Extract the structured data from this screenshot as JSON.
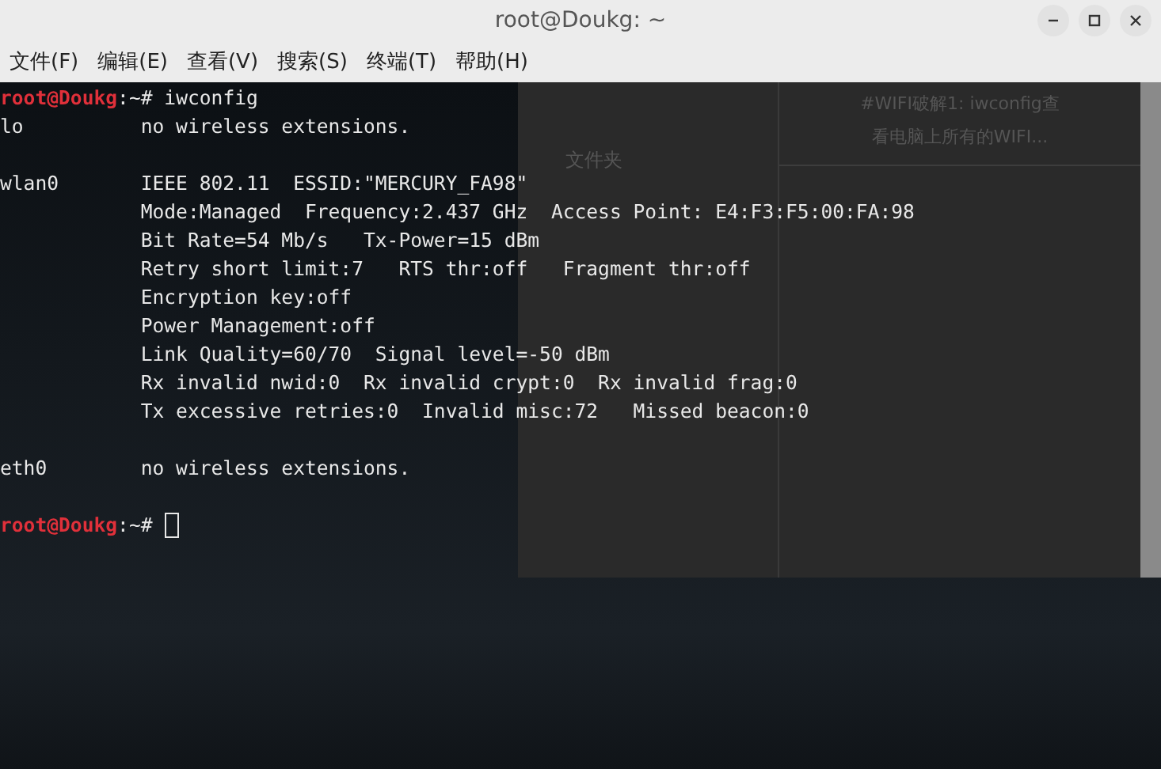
{
  "window": {
    "title": "root@Doukg: ~"
  },
  "menu": [
    "文件(F)",
    "编辑(E)",
    "查看(V)",
    "搜索(S)",
    "终端(T)",
    "帮助(H)"
  ],
  "background_window": {
    "folder_label": "文件夹",
    "article_lines": [
      "#WIFI破解1: iwconfig查",
      "看电脑上所有的WIFI..."
    ]
  },
  "terminal": {
    "lines": [
      {
        "kind": "prompt",
        "user_host": "root@Doukg",
        "path": ":~# ",
        "command": "iwconfig",
        "cursor": false
      },
      {
        "kind": "output",
        "iface": "lo",
        "text": "no wireless extensions."
      },
      {
        "kind": "blank"
      },
      {
        "kind": "output",
        "iface": "wlan0",
        "text": "IEEE 802.11  ESSID:\"MERCURY_FA98\""
      },
      {
        "kind": "output",
        "text": "Mode:Managed  Frequency:2.437 GHz  Access Point: E4:F3:F5:00:FA:98"
      },
      {
        "kind": "output",
        "text": "Bit Rate=54 Mb/s   Tx-Power=15 dBm"
      },
      {
        "kind": "output",
        "text": "Retry short limit:7   RTS thr:off   Fragment thr:off"
      },
      {
        "kind": "output",
        "text": "Encryption key:off"
      },
      {
        "kind": "output",
        "text": "Power Management:off"
      },
      {
        "kind": "output",
        "text": "Link Quality=60/70  Signal level=-50 dBm"
      },
      {
        "kind": "output",
        "text": "Rx invalid nwid:0  Rx invalid crypt:0  Rx invalid frag:0"
      },
      {
        "kind": "output",
        "text": "Tx excessive retries:0  Invalid misc:72   Missed beacon:0"
      },
      {
        "kind": "blank"
      },
      {
        "kind": "output",
        "iface": "eth0",
        "text": "no wireless extensions."
      },
      {
        "kind": "blank"
      },
      {
        "kind": "prompt",
        "user_host": "root@Doukg",
        "path": ":~# ",
        "cursor": true
      }
    ]
  }
}
